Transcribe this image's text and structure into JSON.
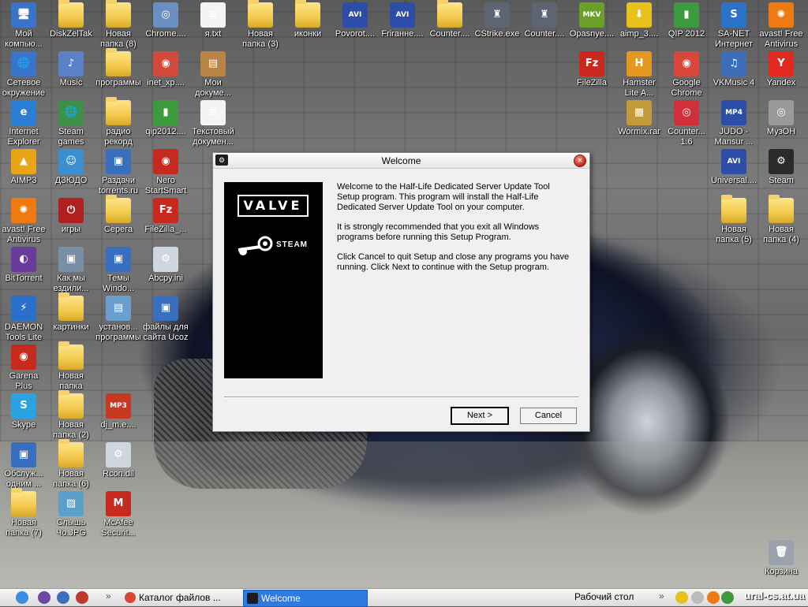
{
  "desktop": {
    "icons": [
      {
        "label": "Мой компью...",
        "glyph": "🖥",
        "bg": "#3a74c9"
      },
      {
        "label": "DiskZelTak",
        "glyph": "",
        "bg": "folder"
      },
      {
        "label": "Новая папка (8)",
        "glyph": "",
        "bg": "folder"
      },
      {
        "label": "Chrome....",
        "glyph": "◎",
        "bg": "#6a8fc2"
      },
      {
        "label": "я.txt",
        "glyph": "≡",
        "bg": "#f4f4f4"
      },
      {
        "label": "Новая папка (3)",
        "glyph": "",
        "bg": "folder"
      },
      {
        "label": "иконки",
        "glyph": "",
        "bg": "folder"
      },
      {
        "label": "Povorot....",
        "glyph": "AVI",
        "bg": "#2c4ea8"
      },
      {
        "label": "Frirанне....",
        "glyph": "AVI",
        "bg": "#2c4ea8"
      },
      {
        "label": "Counter....",
        "glyph": "",
        "bg": "folder"
      },
      {
        "label": "CStrike.exe",
        "glyph": "♜",
        "bg": "#5d6572"
      },
      {
        "label": "Counter....",
        "glyph": "♜",
        "bg": "#5d6572"
      },
      {
        "label": "Opasnye....",
        "glyph": "MKV",
        "bg": "#6a9f2a"
      },
      {
        "label": "aimp_3....",
        "glyph": "⬇",
        "bg": "#e8c21c"
      },
      {
        "label": "QIP 2012",
        "glyph": "▮",
        "bg": "#3d9a3d"
      },
      {
        "label": "SA-NET Интернет",
        "glyph": "S",
        "bg": "#2a73c8"
      },
      {
        "label": "avast! Free Antivirus",
        "glyph": "✺",
        "bg": "#f07a12"
      },
      {
        "label": "Сетевое окружение",
        "glyph": "🌐",
        "bg": "#3a74c9"
      },
      {
        "label": "Music",
        "glyph": "♪",
        "bg": "#5b82c9"
      },
      {
        "label": "программы",
        "glyph": "",
        "bg": "folder"
      },
      {
        "label": "inet_xp....",
        "glyph": "◉",
        "bg": "#d24a3a"
      },
      {
        "label": "Мои докуме...",
        "glyph": "▤",
        "bg": "#b98544"
      },
      {
        "label": "FileZilla",
        "glyph": "Fz",
        "bg": "#c9281f"
      },
      {
        "label": "Hamster Lite A...",
        "glyph": "H",
        "bg": "#e39920"
      },
      {
        "label": "Google Chrome",
        "glyph": "◉",
        "bg": "#d9463a"
      },
      {
        "label": "VKMusic 4",
        "glyph": "♫",
        "bg": "#3d6fb8"
      },
      {
        "label": "Yandex",
        "glyph": "Y",
        "bg": "#e02a20"
      },
      {
        "label": "Internet Explorer",
        "glyph": "e",
        "bg": "#2a7fd4"
      },
      {
        "label": "Steam games",
        "glyph": "🌐",
        "bg": "#3d8f4a"
      },
      {
        "label": "радио рекорд",
        "glyph": "",
        "bg": "folder"
      },
      {
        "label": "qip2012....",
        "glyph": "▮",
        "bg": "#3d9a3d"
      },
      {
        "label": "Текстовый докумен...",
        "glyph": "≡",
        "bg": "#f4f4f4"
      },
      {
        "label": "Wormix.rar",
        "glyph": "▦",
        "bg": "#c29a3a"
      },
      {
        "label": "Counter... 1.6",
        "glyph": "◎",
        "bg": "#d0303a"
      },
      {
        "label": "JUDO -Mansur ...",
        "glyph": "MP4",
        "bg": "#2c4ea8"
      },
      {
        "label": "МузОН",
        "glyph": "◎",
        "bg": "#9a9a9a"
      },
      {
        "label": "AIMP3",
        "glyph": "▲",
        "bg": "#e8a517"
      },
      {
        "label": "ДЗЮДО",
        "glyph": "☺",
        "bg": "#3a8fd0"
      },
      {
        "label": "Раздачи torrents.ru",
        "glyph": "▣",
        "bg": "#3a6fc0"
      },
      {
        "label": "Nero StartSmart",
        "glyph": "◉",
        "bg": "#c62a1f"
      },
      {
        "label": "Universal....",
        "glyph": "AVI",
        "bg": "#2c4ea8"
      },
      {
        "label": "Steam",
        "glyph": "⚙",
        "bg": "#2b2b2b"
      },
      {
        "label": "avast! Free Antivirus",
        "glyph": "✺",
        "bg": "#f07a12"
      },
      {
        "label": "игры",
        "glyph": "⏻",
        "bg": "#b02020"
      },
      {
        "label": "Серега",
        "glyph": "",
        "bg": "folder"
      },
      {
        "label": "FileZilla_...",
        "glyph": "Fz",
        "bg": "#c9281f"
      },
      {
        "label": "Новая папка (5)",
        "glyph": "",
        "bg": "folder"
      },
      {
        "label": "Новая папка (4)",
        "glyph": "",
        "bg": "folder"
      },
      {
        "label": "BitTorrent",
        "glyph": "◐",
        "bg": "#6b3b9c"
      },
      {
        "label": "Как мы ездили...",
        "glyph": "▣",
        "bg": "#7a8fa6"
      },
      {
        "label": "Темы Windo...",
        "glyph": "▣",
        "bg": "#3a6fc0"
      },
      {
        "label": "Abcpy.ini",
        "glyph": "⚙",
        "bg": "#cfd6e0"
      },
      {
        "label": "DAEMON Tools Lite",
        "glyph": "⚡",
        "bg": "#2a6fc9"
      },
      {
        "label": "картинки",
        "glyph": "",
        "bg": "folder"
      },
      {
        "label": "установ... программы",
        "glyph": "▤",
        "bg": "#6a9fd0"
      },
      {
        "label": "файлы для сайта Ucoz",
        "glyph": "▣",
        "bg": "#3a6fc0"
      },
      {
        "label": "Garena Plus",
        "glyph": "◉",
        "bg": "#c62a1f"
      },
      {
        "label": "Новая папка",
        "glyph": "",
        "bg": "folder"
      },
      {
        "label": "Skype",
        "glyph": "S",
        "bg": "#2aa3e0"
      },
      {
        "label": "Новая папка (2)",
        "glyph": "",
        "bg": "folder"
      },
      {
        "label": "dj_m.e....",
        "glyph": "MP3",
        "bg": "#c6381f"
      },
      {
        "label": "Обслуж... одним ...",
        "glyph": "▣",
        "bg": "#3a6fc0"
      },
      {
        "label": "Новая папка (6)",
        "glyph": "",
        "bg": "folder"
      },
      {
        "label": "Rcon.dll",
        "glyph": "⚙",
        "bg": "#cfd6e0"
      },
      {
        "label": "Новая папка (7)",
        "glyph": "",
        "bg": "folder"
      },
      {
        "label": "Слышь Чо.JPG",
        "glyph": "▨",
        "bg": "#5aa0c8"
      },
      {
        "label": "McAfee Securit...",
        "glyph": "M",
        "bg": "#c62a1f"
      },
      {
        "label": "Корзина",
        "glyph": "🗑",
        "bg": "#9aa3ad"
      }
    ]
  },
  "dialog": {
    "title": "Welcome",
    "valve_logo": "VALVE",
    "steam_logo": "STEAM",
    "paragraph1": "Welcome to the Half-Life Dedicated Server Update Tool Setup program. This program will install the Half-Life Dedicated Server Update Tool on your computer.",
    "paragraph2": "It is strongly recommended that you exit all Windows programs before running this Setup Program.",
    "paragraph3": "Click Cancel to quit Setup and close any programs you have running.  Click Next to continue with the Setup program.",
    "next_label": "Next >",
    "cancel_label": "Cancel"
  },
  "taskbar": {
    "tasks": [
      {
        "label": "Каталог файлов ...",
        "active": false
      },
      {
        "label": "Welcome",
        "active": true
      }
    ],
    "desktop_toolbar": "Рабочий стол",
    "watermark": "ural-cs.at.ua"
  },
  "colors": {
    "taskbar_active": "#2f7ae0",
    "dialog_bg": "#f0f0f0"
  }
}
